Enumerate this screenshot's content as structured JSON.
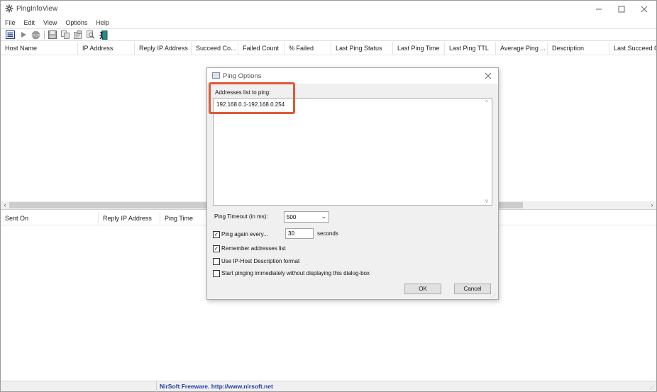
{
  "window": {
    "title": "PingInfoView"
  },
  "menu": [
    "File",
    "Edit",
    "View",
    "Options",
    "Help"
  ],
  "toolbar": {
    "icons": [
      "options-icon",
      "start-icon",
      "stop-icon",
      "save-icon",
      "copy-icon",
      "properties-icon",
      "find-icon",
      "exit-icon"
    ]
  },
  "upper_columns": [
    "Host Name",
    "IP Address",
    "Reply IP Address",
    "Succeed Co...",
    "Failed Count",
    "% Failed",
    "Last Ping Status",
    "Last Ping Time",
    "Last Ping TTL",
    "Average Ping ...",
    "Description",
    "Last Succeed O"
  ],
  "lower_columns": [
    "Sent On",
    "Reply IP Address",
    "Ping Time"
  ],
  "status": {
    "text": "NirSoft Freeware.  http://www.nirsoft.net"
  },
  "dialog": {
    "title": "Ping Options",
    "addresses_label": "Addresses list to ping:",
    "addresses_value": "192.168.0.1-192.168.0.254",
    "timeout_label": "Ping Timeout (in ms):",
    "timeout_value": "500",
    "ping_again_label": "Ping again every...",
    "ping_again_checked": true,
    "ping_again_value": "30",
    "seconds_label": "seconds",
    "remember_label": "Remember addresses list",
    "remember_checked": true,
    "desc_format_label": "Use IP-Host Description format",
    "desc_format_checked": false,
    "start_immediately_label": "Start pinging immediately without displaying this dialog-box",
    "start_immediately_checked": false,
    "ok_label": "OK",
    "cancel_label": "Cancel",
    "highlight_color": "#de5a35"
  }
}
